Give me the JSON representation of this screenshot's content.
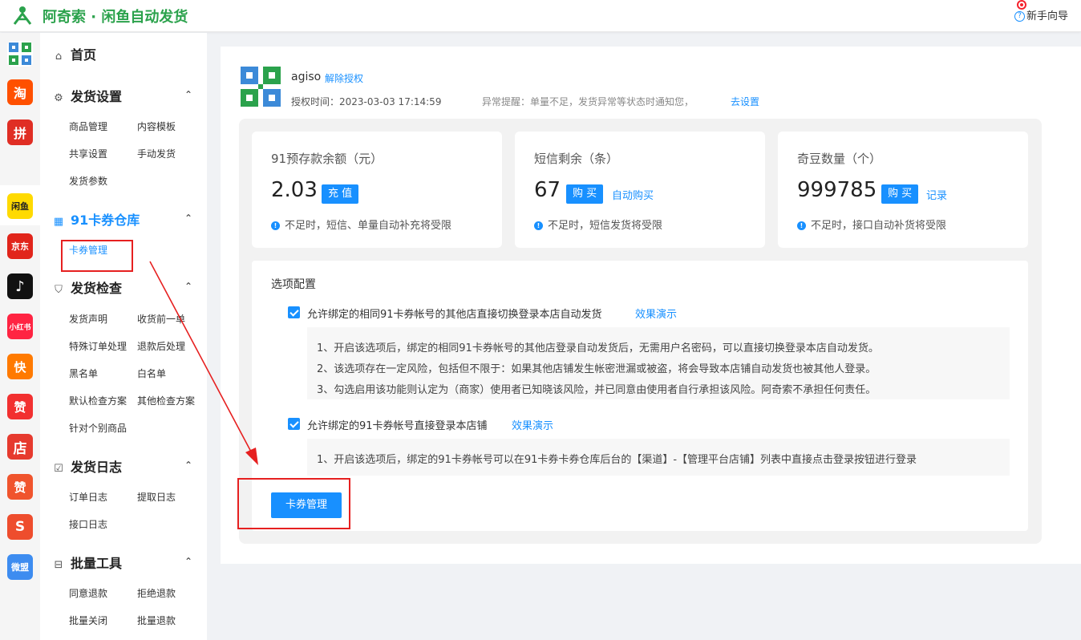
{
  "header": {
    "brand": "阿奇索 · 闲鱼自动发货",
    "guide_label": "新手向导"
  },
  "rail": [
    {
      "name": "multi",
      "label": "",
      "color": "#2a9d47"
    },
    {
      "name": "taobao",
      "label": "淘",
      "color": "#ff5000"
    },
    {
      "name": "pinduoduo",
      "label": "拼",
      "color": "#e02e24"
    },
    {
      "name": "xianyu",
      "label": "闲鱼",
      "color": "#ffda00"
    },
    {
      "name": "jd",
      "label": "京东",
      "color": "#e1251b"
    },
    {
      "name": "douyin",
      "label": "♪",
      "color": "#111111"
    },
    {
      "name": "xiaohongshu",
      "label": "小红书",
      "color": "#ff2442"
    },
    {
      "name": "kuaishou",
      "label": "快",
      "color": "#ff7a00"
    },
    {
      "name": "dianzan",
      "label": "赞",
      "color": "#f23030"
    },
    {
      "name": "weidian",
      "label": "店",
      "color": "#e63a2e"
    },
    {
      "name": "youzan",
      "label": "赞",
      "color": "#f0542d"
    },
    {
      "name": "shopee",
      "label": "S",
      "color": "#ee4d2d"
    },
    {
      "name": "weimeng",
      "label": "微盟",
      "color": "#3d8cf0"
    }
  ],
  "nav": {
    "home": "首页",
    "sections": [
      {
        "title": "发货设置",
        "links": [
          "商品管理",
          "内容模板",
          "共享设置",
          "手动发货",
          "发货参数"
        ]
      },
      {
        "title": "91卡券仓库",
        "links": [
          "卡券管理"
        ]
      },
      {
        "title": "发货检查",
        "links": [
          "发货声明",
          "收货前一单",
          "特殊订单处理",
          "退款后处理",
          "黑名单",
          "白名单",
          "默认检查方案",
          "其他检查方案",
          "针对个别商品"
        ]
      },
      {
        "title": "发货日志",
        "links": [
          "订单日志",
          "提取日志",
          "接口日志"
        ]
      },
      {
        "title": "批量工具",
        "links": [
          "同意退款",
          "拒绝退款",
          "批量关闭",
          "批量退款"
        ]
      }
    ]
  },
  "shop": {
    "name": "agiso",
    "unbind": "解除授权",
    "auth_time": "授权时间：2023-03-03 17:14:59",
    "alert": "异常提醒：单量不足，发货异常等状态时通知您，",
    "alert_link": "去设置"
  },
  "cards": [
    {
      "label": "91预存款余额（元）",
      "value": "2.03",
      "button": "充 值",
      "link": "",
      "note": "不足时，短信、单量自动补充将受限"
    },
    {
      "label": "短信剩余（条）",
      "value": "67",
      "button": "购 买",
      "link": "自动购买",
      "note": "不足时，短信发货将受限"
    },
    {
      "label": "奇豆数量（个）",
      "value": "999785",
      "button": "购 买",
      "link": "记录",
      "note": "不足时，接口自动补货将受限"
    }
  ],
  "options": {
    "title": "选项配置",
    "items": [
      {
        "checked": true,
        "label": "允许绑定的相同91卡券帐号的其他店直接切换登录本店自动发货",
        "demo": "效果演示",
        "desc": [
          "1、开启该选项后，绑定的相同91卡券帐号的其他店登录自动发货后，无需用户名密码，可以直接切换登录本店自动发货。",
          "2、该选项存在一定风险，包括但不限于：如果其他店铺发生帐密泄漏或被盗，将会导致本店铺自动发货也被其他人登录。",
          "3、勾选启用该功能则认定为（商家）使用者已知晓该风险，并已同意由使用者自行承担该风险。阿奇索不承担任何责任。"
        ]
      },
      {
        "checked": true,
        "label": "允许绑定的91卡券帐号直接登录本店铺",
        "demo": "效果演示",
        "desc": [
          "1、开启该选项后，绑定的91卡券帐号可以在91卡券卡券仓库后台的【渠道】-【管理平台店铺】列表中直接点击登录按钮进行登录"
        ]
      }
    ],
    "button": "卡券管理"
  },
  "colors": {
    "accent": "#1890ff",
    "brand": "#2ba24c",
    "annotation": "#e62020"
  }
}
